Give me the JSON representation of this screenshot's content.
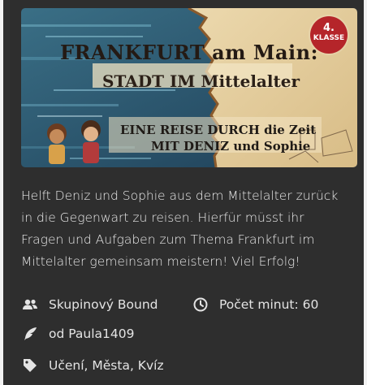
{
  "banner": {
    "title": "FRANKFURT am Main:",
    "subtitle": "STADT IM Mittelalter",
    "line1": "EINE REISE DURCH die Zeit",
    "line2": "MIT DENIZ und Sophie",
    "badge_number": "4.",
    "badge_label": "KLASSE"
  },
  "description": "Helft Deniz und Sophie aus dem Mittelalter zurück in die Gegenwart zu reisen. Hierfür müsst ihr Fragen und Aufgaben zum Thema Frankfurt im Mittelalter gemeinsam meistern! Viel Erfolg!",
  "meta": {
    "type": "Skupinový Bound",
    "time": "Počet minut: 60",
    "author": "od Paula1409",
    "tags": "Učení, Města, Kvíz"
  },
  "colors": {
    "card_bg": "#2e2e2e",
    "text": "#e9e9e9",
    "badge": "#b5252a",
    "parchment": "#e7d2a5"
  },
  "icons": {
    "type": "users-icon",
    "time": "clock-icon",
    "author": "quill-icon",
    "tags": "tag-icon"
  }
}
